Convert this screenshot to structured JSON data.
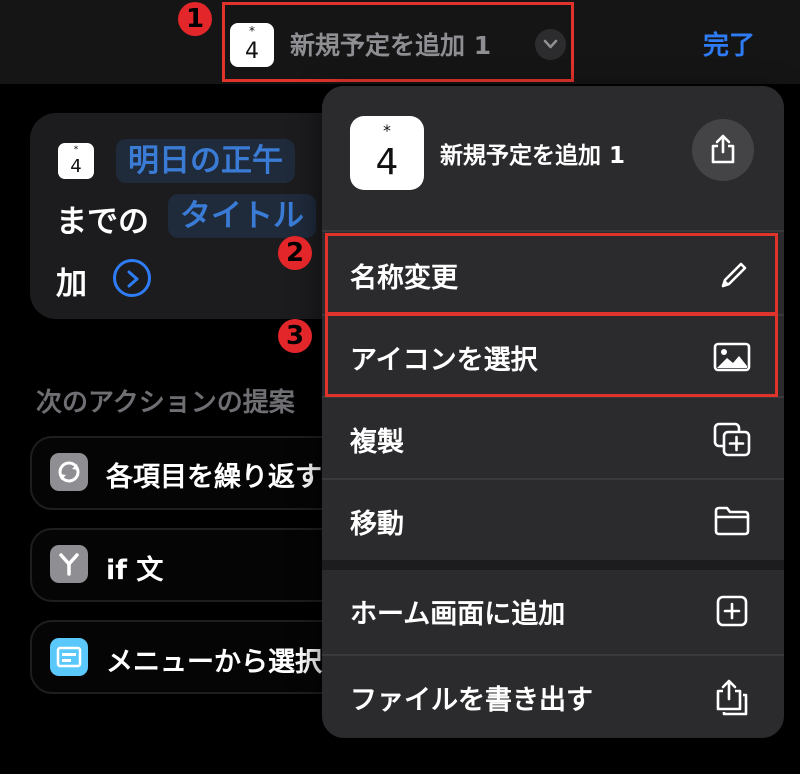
{
  "header": {
    "title": "新規予定を追加 1",
    "done_label": "完了",
    "icon_star": "*",
    "icon_number": "4"
  },
  "markers": [
    "1",
    "2",
    "3"
  ],
  "action_card": {
    "chip_date": "明日の正午",
    "text_until": "までの",
    "chip_title": "タイトル",
    "text_add": "加"
  },
  "suggestions": {
    "title": "次のアクションの提案",
    "items": [
      {
        "label": "各項目を繰り返す",
        "icon": "repeat-icon",
        "color": "#8e8e93"
      },
      {
        "label": "if 文",
        "icon": "branch-icon",
        "color": "#8e8e93"
      },
      {
        "label": "メニューから選択",
        "icon": "menu-icon",
        "color": "#5ac8fa"
      }
    ]
  },
  "menu": {
    "title": "新規予定を追加 1",
    "items": [
      {
        "label": "名称変更",
        "icon": "pencil-icon"
      },
      {
        "label": "アイコンを選択",
        "icon": "photo-icon"
      },
      {
        "label": "複製",
        "icon": "duplicate-icon"
      },
      {
        "label": "移動",
        "icon": "folder-icon"
      },
      {
        "label": "ホーム画面に追加",
        "icon": "add-square-icon"
      },
      {
        "label": "ファイルを書き出す",
        "icon": "export-icon"
      }
    ]
  },
  "colors": {
    "accent": "#2e7cf6",
    "highlight": "#e0332b",
    "menu_bg": "#2b2b2d"
  }
}
